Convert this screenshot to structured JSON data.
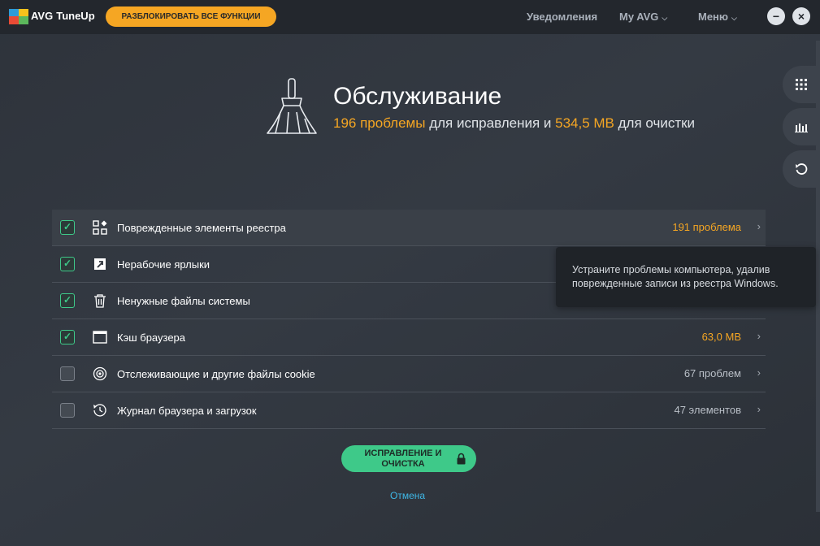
{
  "app": {
    "brand": "AVG",
    "product": "TuneUp"
  },
  "topbar": {
    "unlock_label": "РАЗБЛОКИРОВАТЬ ВСЕ ФУНКЦИИ",
    "notifications": "Уведомления",
    "my_avg": "My AVG",
    "menu": "Меню",
    "minimize": "−",
    "close": "×"
  },
  "header": {
    "title": "Обслуживание",
    "problems_count": "196 проблемы",
    "mid_text": " для исправления и ",
    "size": "534,5 MB",
    "end_text": " для очистки"
  },
  "items": [
    {
      "label": "Поврежденные элементы реестра",
      "value": "191 проблема",
      "checked": true,
      "icon": "registry-icon"
    },
    {
      "label": "Нерабочие ярлыки",
      "value": "",
      "checked": true,
      "icon": "shortcut-icon"
    },
    {
      "label": "Ненужные файлы системы",
      "value": "",
      "checked": true,
      "icon": "trash-icon"
    },
    {
      "label": "Кэш браузера",
      "value": "63,0 MB",
      "checked": true,
      "icon": "browser-window-icon"
    },
    {
      "label": "Отслеживающие и другие файлы cookie",
      "value": "67 проблем",
      "checked": false,
      "icon": "tracking-icon"
    },
    {
      "label": "Журнал браузера и загрузок",
      "value": "47 элементов",
      "checked": false,
      "icon": "history-icon"
    }
  ],
  "tooltip": {
    "text": "Устраните проблемы компьютера, удалив поврежденные записи из реестра Windows."
  },
  "actions": {
    "fix_label": "ИСПРАВЛЕНИЕ И ОЧИСТКА",
    "cancel": "Отмена"
  },
  "colors": {
    "accent_orange": "#f5a623",
    "accent_green": "#3ec989",
    "link_blue": "#3fb7e6"
  }
}
